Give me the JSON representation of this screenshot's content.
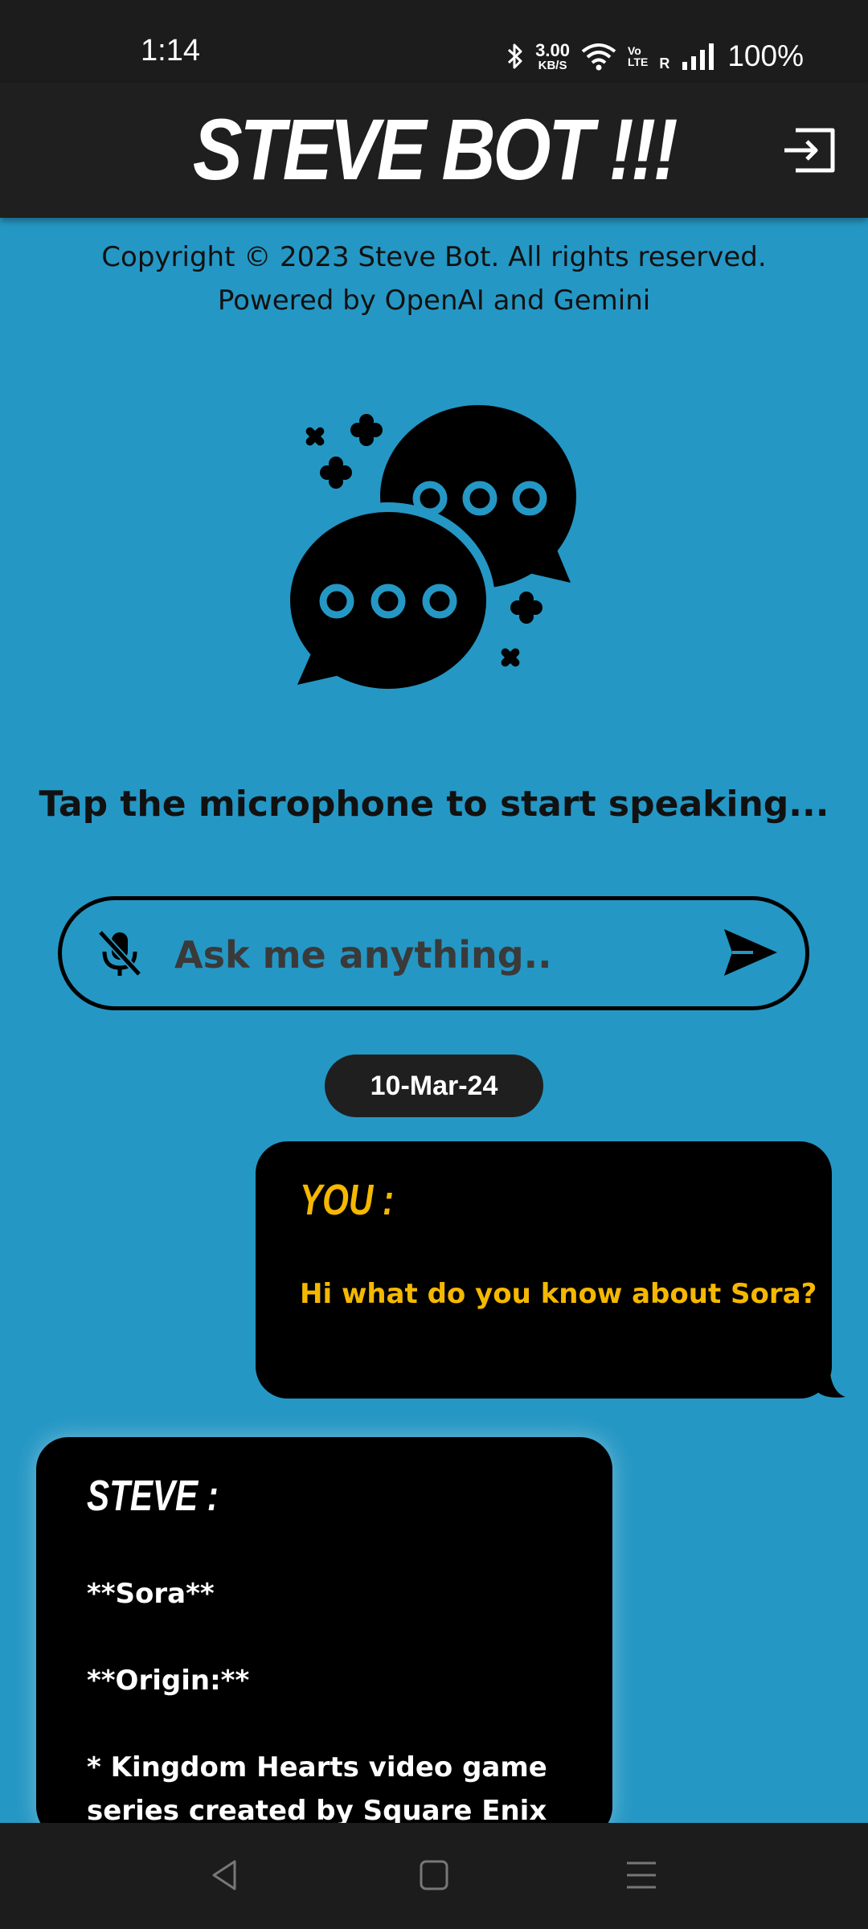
{
  "status_bar": {
    "time": "1:14",
    "net_speed_value": "3.00",
    "net_speed_unit": "KB/S",
    "volte_top": "Vo",
    "volte_bottom": "LTE",
    "roaming": "R",
    "battery": "100%",
    "icons": [
      "bluetooth-icon",
      "wifi-icon",
      "signal-icon"
    ]
  },
  "header": {
    "title": "STEVE BOT !!!",
    "logout_icon": "logout-icon"
  },
  "footer_info": {
    "copyright": "Copyright © 2023 Steve Bot. All rights reserved.",
    "powered_by": "Powered by OpenAI and Gemini"
  },
  "illustration": {
    "icon": "chat-bubbles-icon"
  },
  "hint": "Tap the microphone to start speaking...",
  "input": {
    "placeholder": "Ask me anything..",
    "value": "",
    "mic_icon": "mic-off-icon",
    "send_icon": "send-icon"
  },
  "chat": {
    "date": "10-Mar-24",
    "messages": [
      {
        "sender": "YOU :",
        "text": "Hi what do you know about Sora?"
      },
      {
        "sender": "STEVE :",
        "lines": [
          "**Sora**",
          "**Origin:**",
          "* Kingdom Hearts video game series created by Square Enix"
        ]
      }
    ]
  },
  "colors": {
    "background": "#2597c4",
    "header": "#1f1f1f",
    "bubble": "#000000",
    "user_text": "#f5b800",
    "bot_text": "#ffffff"
  },
  "nav": {
    "back": "back-icon",
    "home": "home-icon",
    "recents": "recents-icon"
  }
}
